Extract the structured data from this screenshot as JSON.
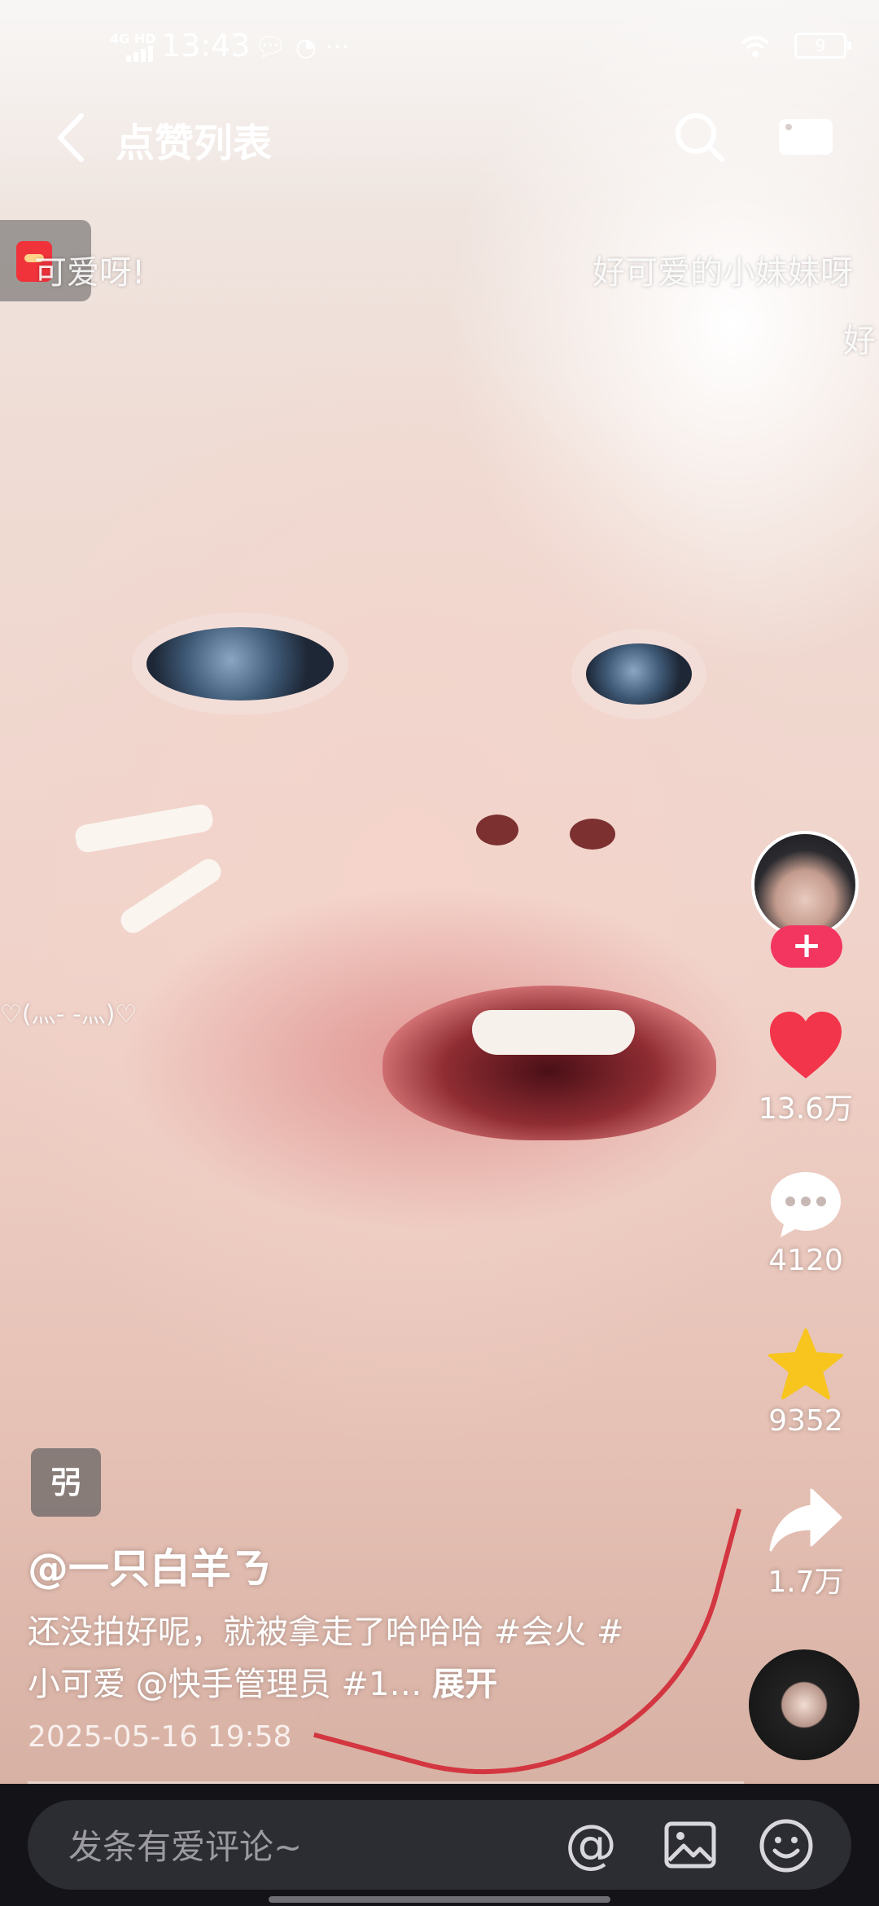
{
  "status_bar": {
    "network": "4G HD",
    "time": "13:43",
    "more": "···",
    "battery": "9"
  },
  "header": {
    "title": "点赞列表"
  },
  "danmaku": [
    "可爱呀!",
    "好可爱的小妹妹呀",
    "好",
    "♡(灬- -灬)♡"
  ],
  "actions": {
    "follow_symbol": "+",
    "likes": "13.6万",
    "comments": "4120",
    "favorites": "9352",
    "shares": "1.7万"
  },
  "post": {
    "tag": "弜",
    "author": "@一只白羊ㄋ",
    "caption": "还没拍好呢，就被拿走了哈哈哈 #会火 #小可爱 @快手管理员 #1…",
    "expand_label": "展开",
    "time": "2025-05-16 19:58",
    "progress": 0
  },
  "comment_bar": {
    "placeholder": "发条有爱评论~",
    "at_symbol": "@"
  },
  "colors": {
    "like": "#f2354a",
    "favorite": "#f7c51e",
    "follow": "#f23660",
    "bar_bg": "#141418"
  }
}
